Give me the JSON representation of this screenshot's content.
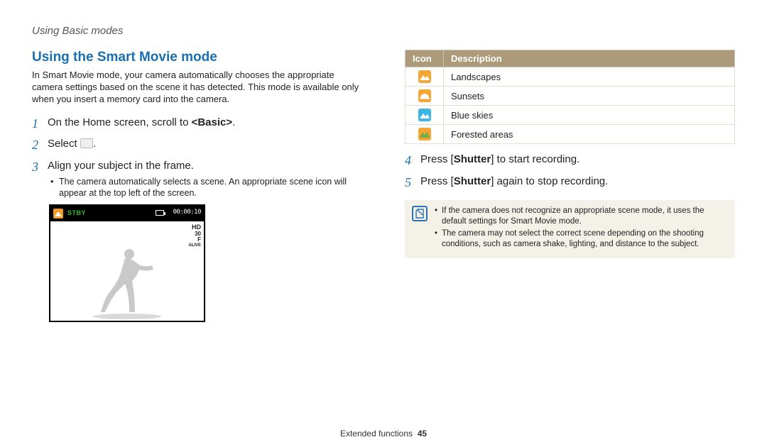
{
  "breadcrumb": "Using Basic modes",
  "section_title": "Using the Smart Movie mode",
  "intro": "In Smart Movie mode, your camera automatically chooses the appropriate camera settings based on the scene it has detected. This mode is available only when you insert a memory card into the camera.",
  "steps_left": {
    "s1": {
      "num": "1",
      "pre": "On the Home screen, scroll to ",
      "bold": "<Basic>",
      "post": "."
    },
    "s2": {
      "num": "2",
      "pre": "Select ",
      "post": "."
    },
    "s3": {
      "num": "3",
      "text": "Align your subject in the frame.",
      "sub": "The camera automatically selects a scene. An appropriate scene icon will appear at the top left of the screen."
    }
  },
  "preview": {
    "stby": "STBY",
    "time": "00:00:10",
    "hd": "HD",
    "hd_sub1": "30",
    "hd_sub2": "F",
    "hd_sub3": "ALIVE"
  },
  "table": {
    "head_icon": "Icon",
    "head_desc": "Description",
    "rows": [
      {
        "kind": "landscapes",
        "label": "Landscapes"
      },
      {
        "kind": "sunsets",
        "label": "Sunsets"
      },
      {
        "kind": "blueskies",
        "label": "Blue skies"
      },
      {
        "kind": "forested",
        "label": "Forested areas"
      }
    ]
  },
  "steps_right": {
    "s4": {
      "num": "4",
      "pre": "Press [",
      "bold": "Shutter",
      "post": "] to start recording."
    },
    "s5": {
      "num": "5",
      "pre": "Press [",
      "bold": "Shutter",
      "post": "] again to stop recording."
    }
  },
  "notes": [
    "If the camera does not recognize an appropriate scene mode, it uses the default settings for Smart Movie mode.",
    "The camera may not select the correct scene depending on the shooting conditions, such as camera shake, lighting, and distance to the subject."
  ],
  "footer": {
    "label": "Extended functions",
    "page": "45"
  }
}
